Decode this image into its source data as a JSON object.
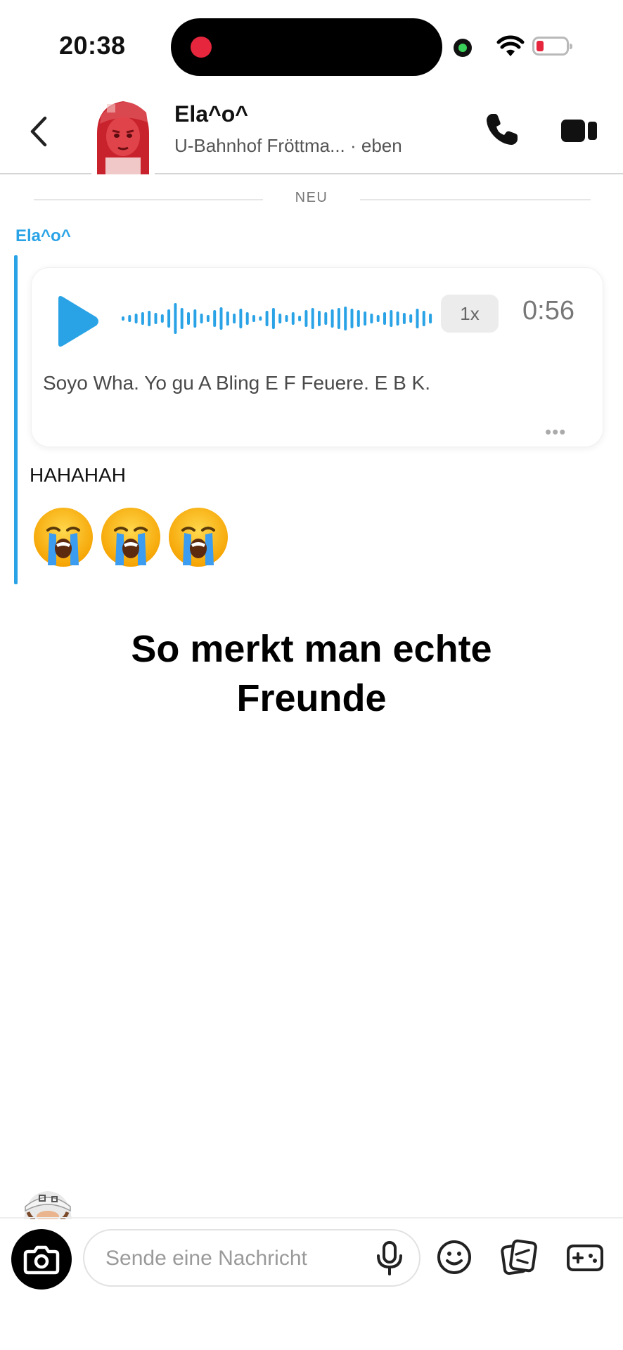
{
  "status_bar": {
    "time": "20:38"
  },
  "header": {
    "contact_name": "Ela^o^",
    "location": "U-Bahnhof Fröttma...",
    "last_seen": "· eben"
  },
  "chat": {
    "divider_label": "NEU",
    "sender_name": "Ela^o^",
    "voice_note": {
      "speed": "1x",
      "duration": "0:56",
      "transcript": "Soyo Wha. Yo gu A Bling E F Feuere. E B K.",
      "more": "•••"
    },
    "message_text": "HAHAHAH",
    "emojis": [
      "loudly-crying-face",
      "loudly-crying-face",
      "loudly-crying-face"
    ]
  },
  "caption": {
    "line1": "So merkt man echte",
    "line2": "Freunde"
  },
  "composer": {
    "placeholder": "Sende eine Nachricht"
  },
  "colors": {
    "accent_blue": "#2aa3e6",
    "record_red": "#e5263d",
    "online_green": "#3ad15a"
  }
}
